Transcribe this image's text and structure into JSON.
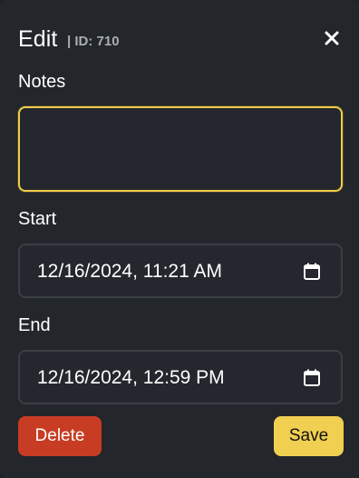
{
  "dialog": {
    "title": "Edit",
    "subtitle": "| ID: 710",
    "close_icon": "close-icon"
  },
  "form": {
    "notes": {
      "label": "Notes",
      "value": "",
      "placeholder": ""
    },
    "start": {
      "label": "Start",
      "value": "12/16/2024, 11:21 AM",
      "icon": "calendar-icon"
    },
    "end": {
      "label": "End",
      "value": "12/16/2024, 12:59 PM",
      "icon": "calendar-icon"
    }
  },
  "actions": {
    "delete_label": "Delete",
    "save_label": "Save"
  },
  "colors": {
    "background": "#23262b",
    "field_border": "#3a3e46",
    "focus_border": "#f1cc4a",
    "delete": "#c83c24",
    "save": "#f1cf50"
  }
}
